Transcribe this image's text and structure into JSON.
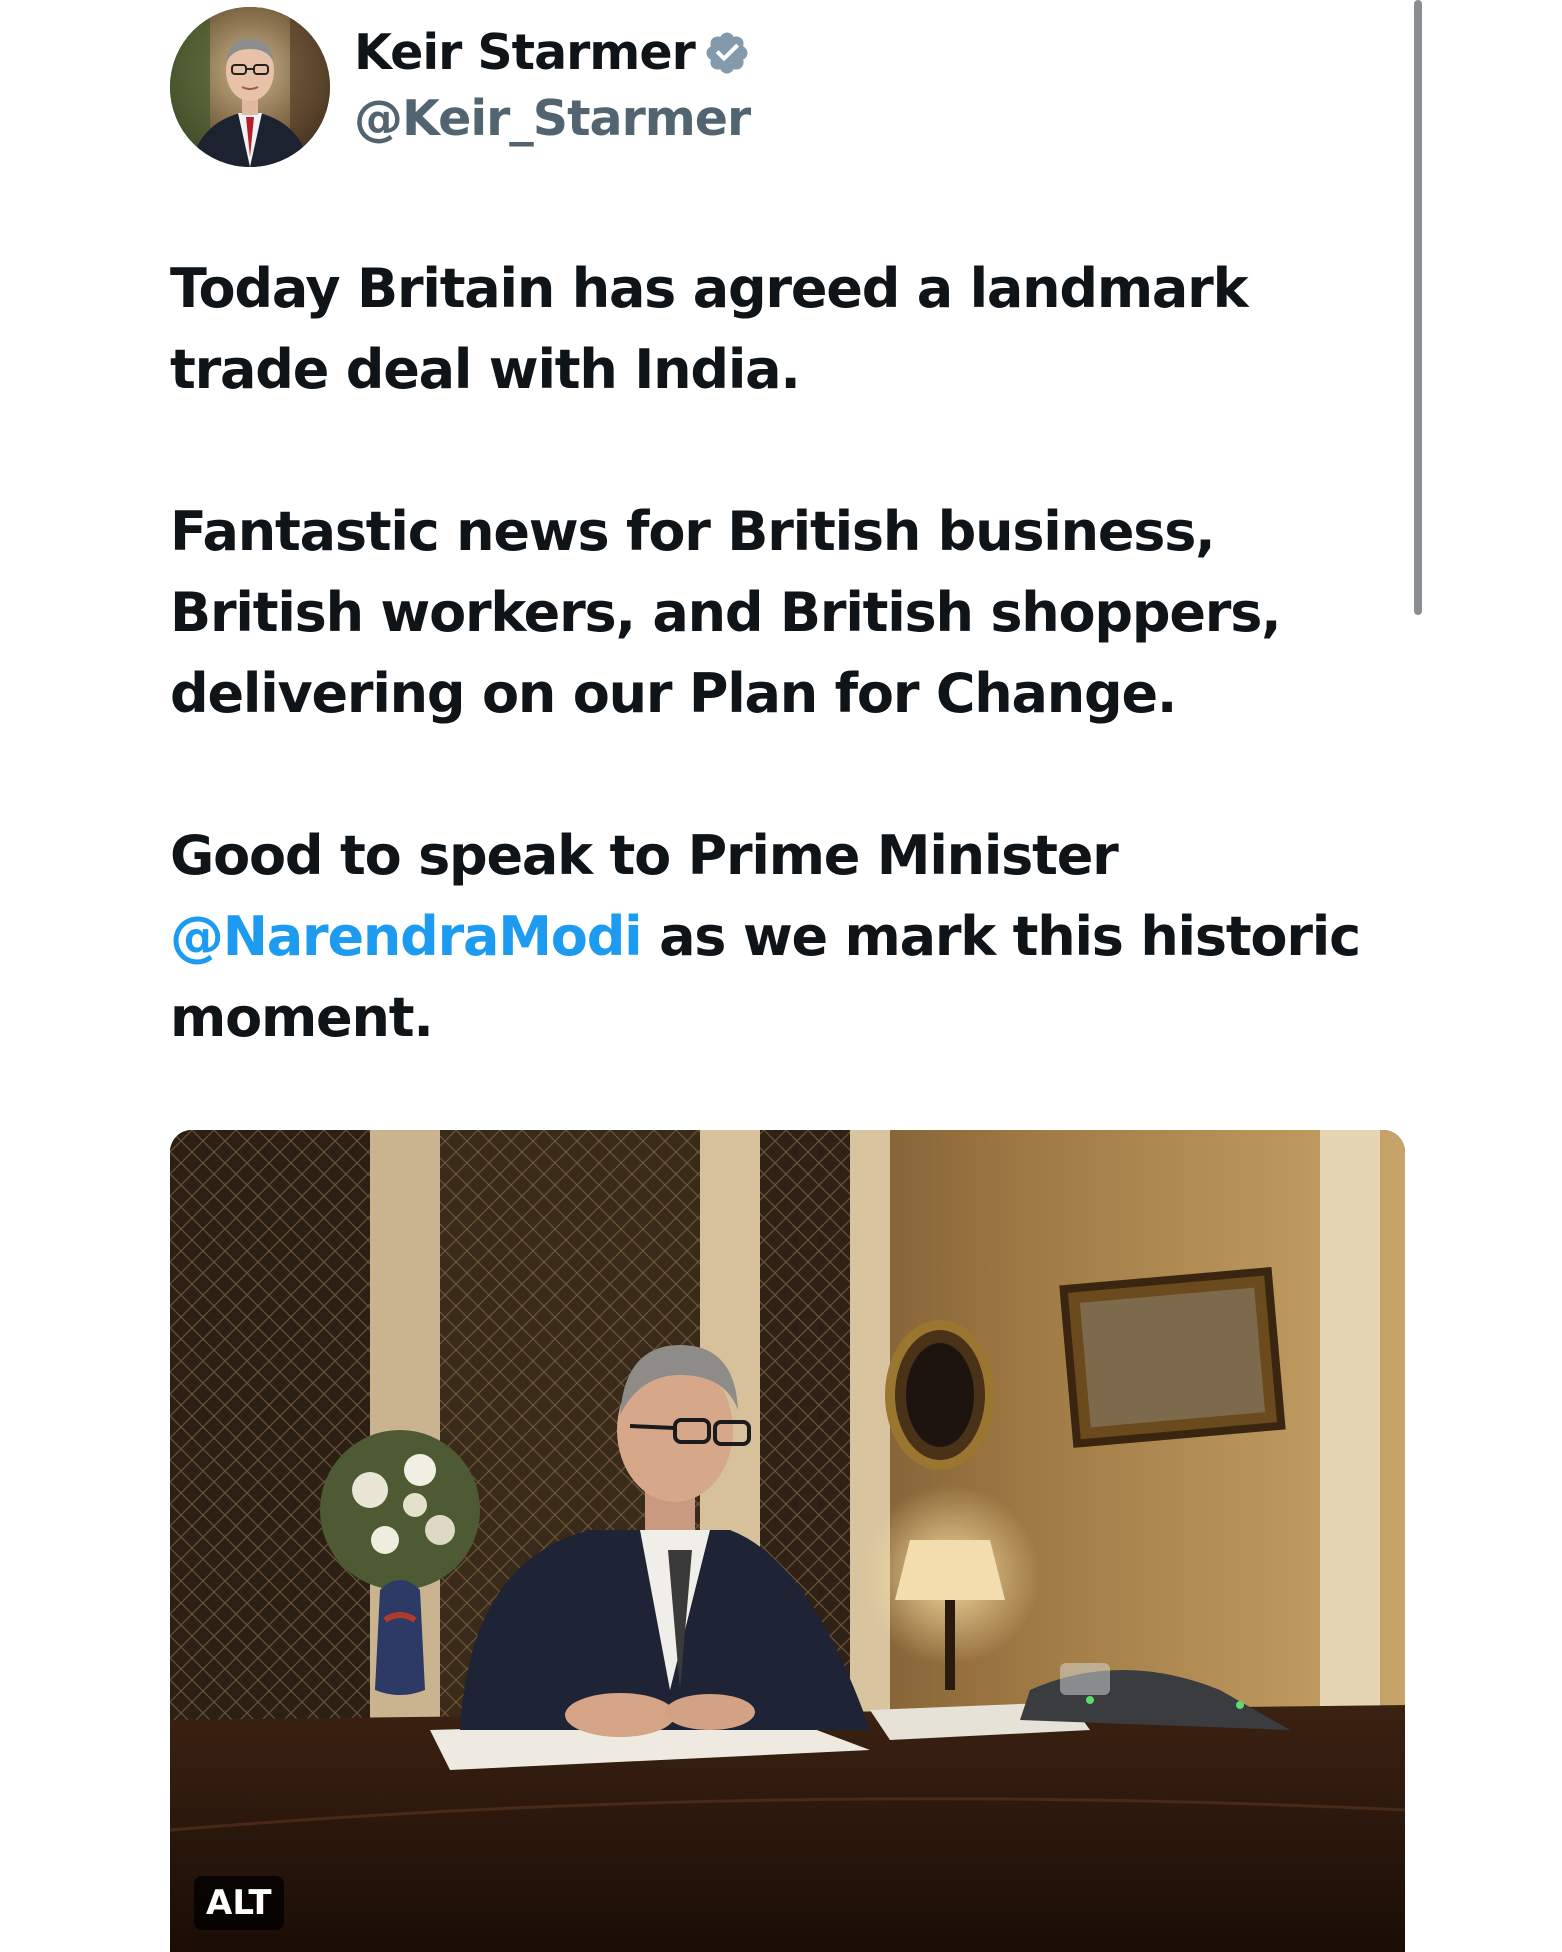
{
  "author": {
    "display_name": "Keir Starmer",
    "handle": "@Keir_Starmer",
    "verified": true,
    "verified_color": "#829aab"
  },
  "tweet": {
    "paragraph1": "Today Britain has agreed a landmark trade deal with India.",
    "paragraph2": "Fantastic news for British business, British workers, and British shoppers, delivering on our Plan for Change.",
    "paragraph3_before": "Good to speak to Prime Minister ",
    "mention": "@NarendraModi",
    "paragraph3_after": " as we mark this historic moment.",
    "mention_color": "#1d9bf0"
  },
  "media": {
    "alt_label": "ALT"
  },
  "icons": {
    "verified": "verified-badge-icon"
  }
}
